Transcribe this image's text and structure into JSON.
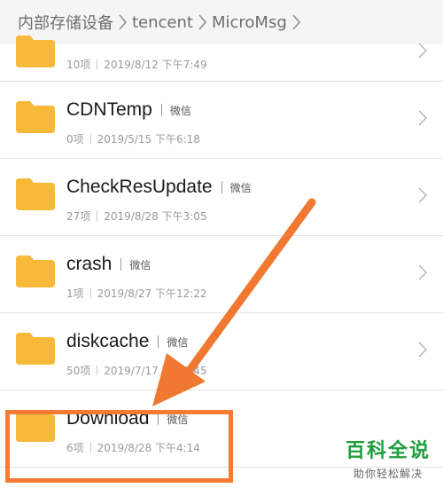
{
  "breadcrumb": [
    "内部存储设备",
    "tencent",
    "MicroMsg"
  ],
  "folders": [
    {
      "name": "",
      "tag": "",
      "count": "10项",
      "date": "2019/8/12 下午7:49"
    },
    {
      "name": "CDNTemp",
      "tag": "微信",
      "count": "0项",
      "date": "2019/5/15 下午6:18"
    },
    {
      "name": "CheckResUpdate",
      "tag": "微信",
      "count": "27项",
      "date": "2019/8/28 下午3:05"
    },
    {
      "name": "crash",
      "tag": "微信",
      "count": "1项",
      "date": "2019/8/27 下午12:22"
    },
    {
      "name": "diskcache",
      "tag": "微信",
      "count": "50项",
      "date": "2019/7/17 下午5:45"
    },
    {
      "name": "Download",
      "tag": "微信",
      "count": "6项",
      "date": "2019/8/28 下午4:14"
    }
  ],
  "watermark": {
    "title": "百科全说",
    "subtitle": "助你轻松解决"
  },
  "colors": {
    "folder": "#f8b93b",
    "highlight": "#f47b33",
    "arrow": "#f07830",
    "brand": "#1f9e3a"
  },
  "icons": {
    "folder": "folder-icon",
    "chevron": "chevron-right-icon",
    "separator": "chevron-right-icon"
  }
}
